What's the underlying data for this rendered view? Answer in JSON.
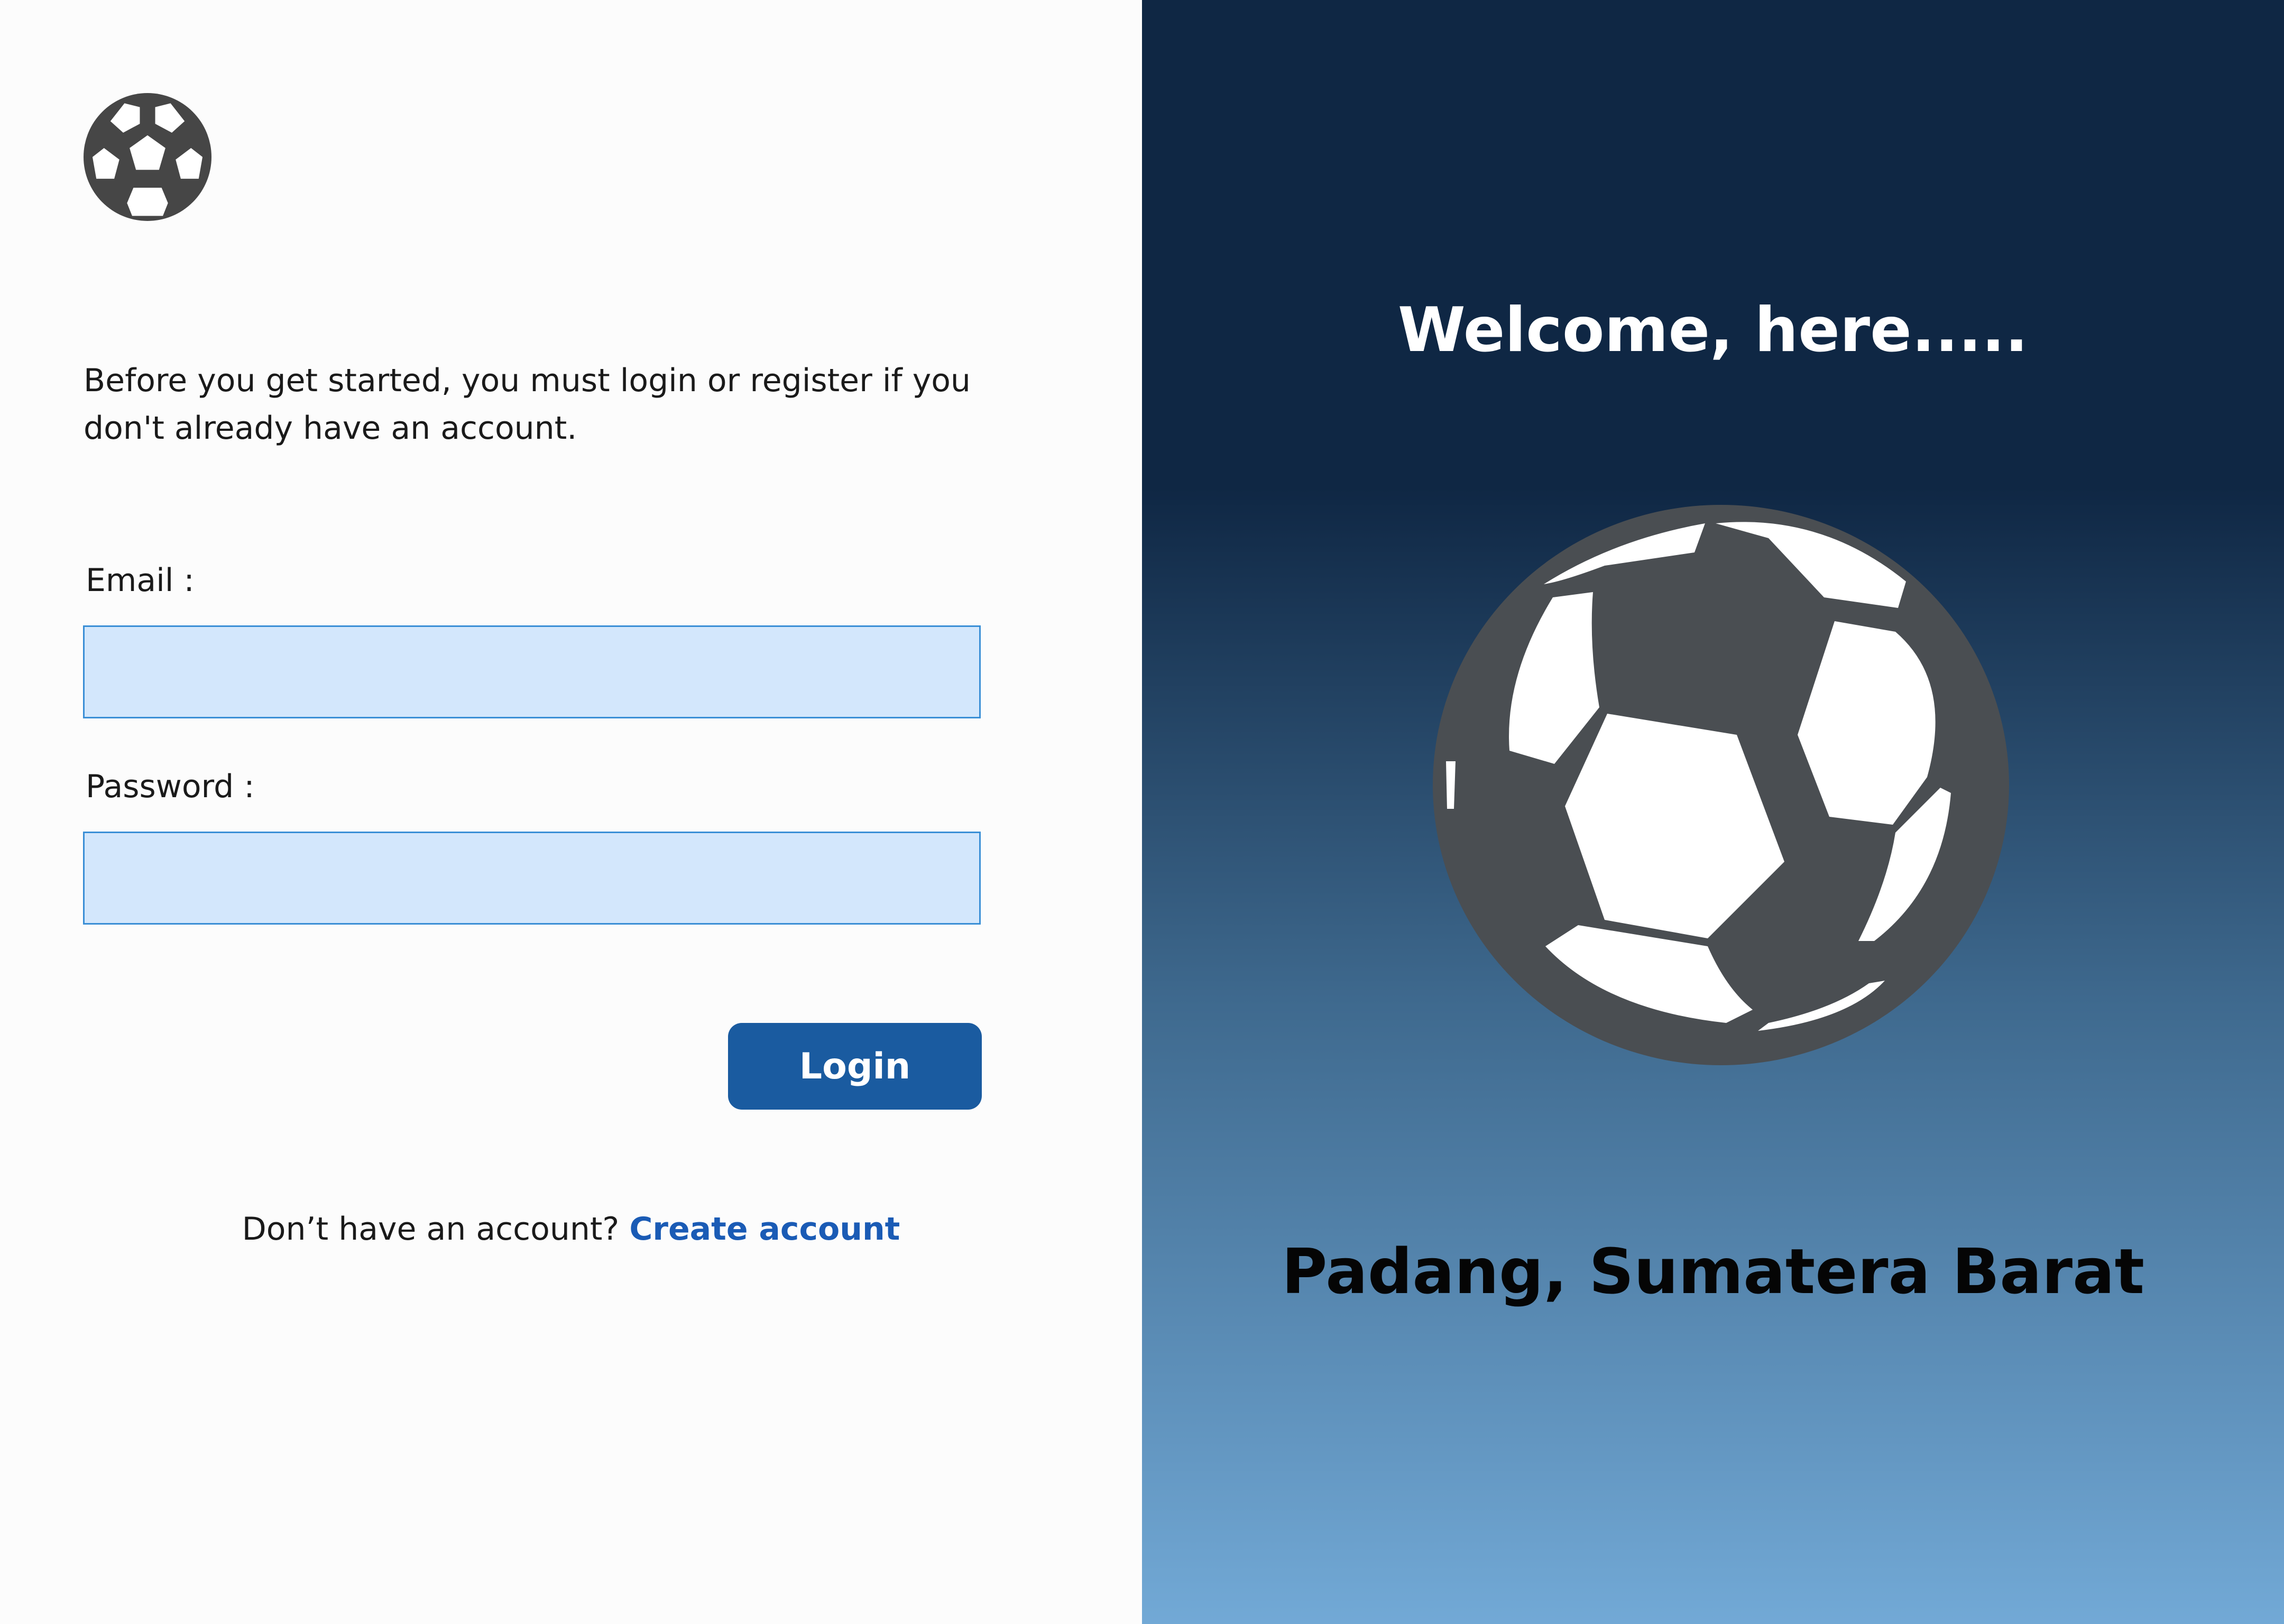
{
  "left": {
    "intro_text": "Before you get started, you must login or register if you don't already have an account.",
    "email_label": "Email :",
    "email_value": "",
    "password_label": "Password :",
    "password_value": "",
    "login_label": "Login",
    "signup_prompt": "Don’t have an account?",
    "signup_link": "Create account"
  },
  "right": {
    "welcome_title": "Welcome, here.....",
    "location": "Padang, Sumatera Barat"
  },
  "icons": {
    "logo": "soccer-ball-icon",
    "illustration": "soccer-ball-illustration"
  },
  "colors": {
    "primary": "#1a5ba0",
    "link": "#1a5bb5",
    "field_bg": "#d3e7fc",
    "field_border": "#3a8fd6",
    "panel_top": "#0f2744",
    "panel_bottom": "#72a9d6"
  }
}
